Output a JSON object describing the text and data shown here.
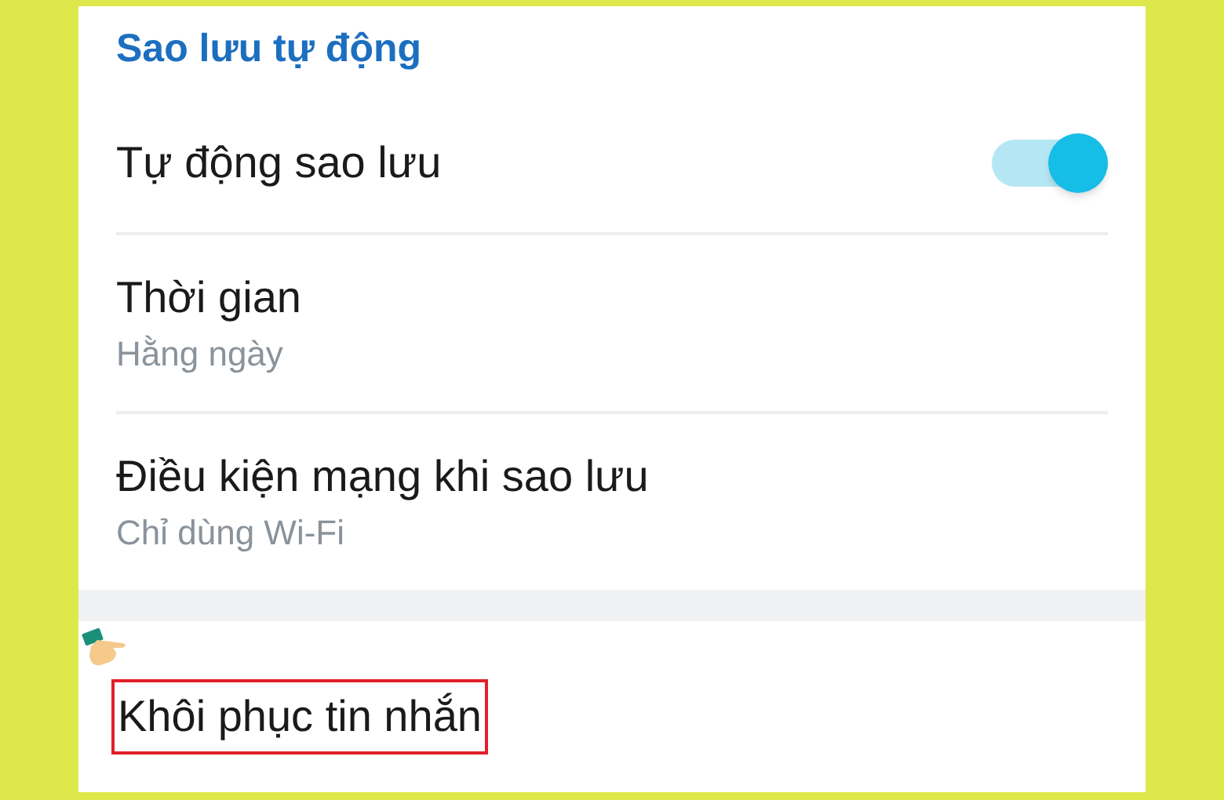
{
  "section_title": "Sao lưu tự động",
  "settings": [
    {
      "kind": "toggle",
      "label": "Tự động sao lưu",
      "on": true
    },
    {
      "kind": "detail",
      "label": "Thời gian",
      "value": "Hằng ngày"
    },
    {
      "kind": "detail",
      "label": "Điều kiện mạng khi sao lưu",
      "value": "Chỉ dùng Wi-Fi"
    }
  ],
  "restore": {
    "label": "Khôi phục tin nhắn",
    "highlighted": true
  }
}
